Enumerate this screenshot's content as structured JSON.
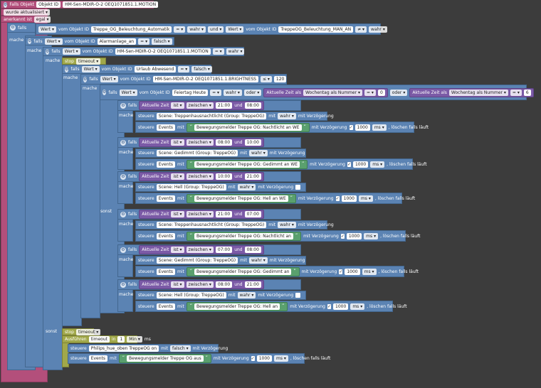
{
  "rows": {
    "r1": [
      "Falls Objekt",
      "Objekt ID",
      "HM-Sen-MDIR-O-2 OEQ1071851.1.MOTION"
    ],
    "r2": [
      "wurde aktualisiert"
    ],
    "r3": [
      "anerkannt ist",
      "egal"
    ],
    "r4": [
      "falls"
    ],
    "r5": [
      "Wert",
      "vom Objekt ID",
      "Treppe_OG_Beleuchtung_Automatik",
      "=",
      "wahr",
      "und",
      "Wert",
      "vom Objekt ID",
      "TreppeOG_Beleuchtung_MAN_AN",
      "≠",
      "wahr"
    ],
    "r6": [
      "mache",
      "falls",
      "Wert",
      "vom Objekt ID",
      "Alarmanlage_an",
      "=",
      "falsch"
    ],
    "r7": [
      "mache",
      "falls",
      "Wert",
      "vom Objekt ID",
      "HM-Sen-MDIR-O-2 OEQ1071851.1.MOTION",
      "=",
      "wahr"
    ],
    "r8": [
      "mache",
      "stop",
      "timeout"
    ],
    "r9": [
      "falls",
      "Wert",
      "vom Objekt ID",
      "Urlaub Abwesend",
      "=",
      "falsch"
    ],
    "r10": [
      "mache",
      "falls",
      "Wert",
      "vom Objekt ID",
      "HM-Sen-MDIR-O-2 OEQ1071851.1.BRIGHTNESS",
      "≤",
      "120"
    ],
    "r11": [
      "mache",
      "falls",
      "Wert",
      "vom Objekt ID",
      "Feiertag Heute",
      "=",
      "wahr",
      "oder",
      "Aktuelle Zeit als",
      "Wochentag als Nummer",
      "=",
      "0",
      "oder",
      "Aktuelle Zeit als",
      "Wochentag als Nummer",
      "=",
      "6"
    ]
  },
  "blocks": [
    {
      "cond": [
        "falls",
        "Aktuelle Zeit",
        "ist",
        "zwischen",
        "21:00",
        "und",
        "08:00"
      ],
      "scene": [
        "mache",
        "steuere",
        "Scene: Treppenhausnachtlicht (Group: TreppeOG)",
        "mit",
        "wahr",
        "mit Verzögerung"
      ],
      "events": [
        "steuere",
        "Events",
        "mit",
        "Bewegungsmelder Treppe OG: Nachtlicht an WE",
        "mit Verzögerung",
        "1000",
        "ms",
        ", löschen falls läuft"
      ]
    },
    {
      "cond": [
        "falls",
        "Aktuelle Zeit",
        "ist",
        "zwischen",
        "08:00",
        "und",
        "10:00"
      ],
      "scene": [
        "mache",
        "steuere",
        "Scene: Gedimmt (Group: TreppeOG)",
        "mit",
        "wahr",
        "mit Verzögerung"
      ],
      "events": [
        "steuere",
        "Events",
        "mit",
        "Bewegungsmelder Treppe OG: Gedimmt an WE",
        "mit Verzögerung",
        "1000",
        "ms",
        ", löschen falls läuft"
      ]
    },
    {
      "cond": [
        "falls",
        "Aktuelle Zeit",
        "ist",
        "zwischen",
        "10:00",
        "und",
        "21:00"
      ],
      "scene": [
        "mache",
        "steuere",
        "Scene: Hell (Group: TreppeOG)",
        "mit",
        "wahr",
        "mit Verzögerung"
      ],
      "events": [
        "steuere",
        "Events",
        "mit",
        "Bewegungsmelder Treppe OG: Hell an WE",
        "mit Verzögerung",
        "1000",
        "ms",
        ", löschen falls läuft"
      ]
    },
    {
      "cond": [
        "sonst",
        "falls",
        "Aktuelle Zeit",
        "ist",
        "zwischen",
        "21:00",
        "und",
        "07:00"
      ],
      "scene": [
        "mache",
        "steuere",
        "Scene: Treppenhausnachtlicht (Group: TreppeOG)",
        "mit",
        "wahr",
        "mit Verzögerung"
      ],
      "events": [
        "steuere",
        "Events",
        "mit",
        "Bewegungsmelder Treppe OG: Nachtlicht an",
        "mit Verzögerung",
        "1000",
        "ms",
        ", löschen falls läuft"
      ]
    },
    {
      "cond": [
        "falls",
        "Aktuelle Zeit",
        "ist",
        "zwischen",
        "07:00",
        "und",
        "08:00"
      ],
      "scene": [
        "mache",
        "steuere",
        "Scene: Gedimmt (Group: TreppeOG)",
        "mit",
        "wahr",
        "mit Verzögerung"
      ],
      "events": [
        "steuere",
        "Events",
        "mit",
        "Bewegungsmelder Treppe OG: Gedimmt an",
        "mit Verzögerung",
        "1000",
        "ms",
        ", löschen falls läuft"
      ]
    },
    {
      "cond": [
        "falls",
        "Aktuelle Zeit",
        "ist",
        "zwischen",
        "08:00",
        "und",
        "21:00"
      ],
      "scene": [
        "mache",
        "steuere",
        "Scene: Hell (Group: TreppeOG)",
        "mit",
        "wahr",
        "mit Verzögerung"
      ],
      "events": [
        "steuere",
        "Events",
        "mit",
        "Bewegungsmelder Treppe OG: Hell an",
        "mit Verzögerung",
        "1000",
        "ms",
        ", löschen falls läuft"
      ]
    }
  ],
  "bottom": {
    "sonst": "sonst",
    "stop": "stop",
    "timeout": "timeout",
    "ausfuhren": "Ausführen",
    "timeout2": "timeout",
    "in": "in",
    "num": "1",
    "unit": "Min",
    "ms": "ms",
    "steuere1": "steuere",
    "obj1": "Philips_hue_oben TreppeOG on",
    "mit1": "mit",
    "val1": "falsch",
    "verz1": "mit Verzögerung",
    "steuere2": "steuere",
    "events": "Events",
    "mit2": "mit",
    "text2": "Bewegungsmelder Treppe OG aus",
    "verz2": "mit Verzögerung",
    "num2": "1000",
    "ms2": "ms",
    "loesch": ", löschen falls läuft"
  }
}
